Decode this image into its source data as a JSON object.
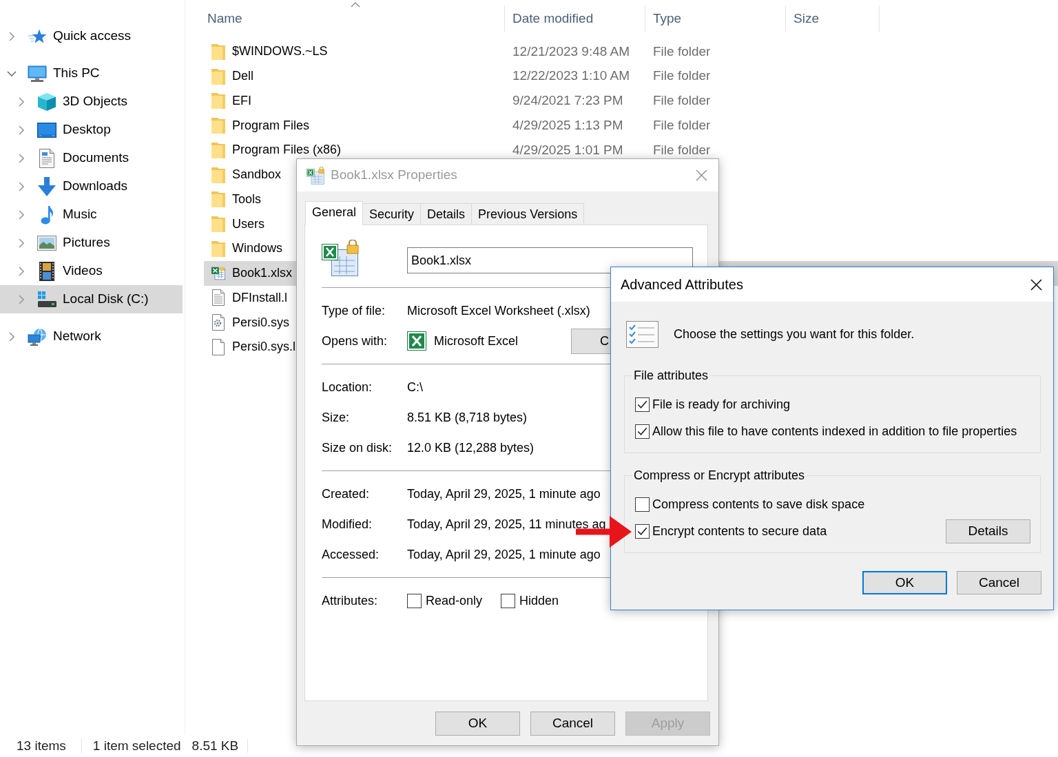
{
  "explorer": {
    "sidebar": {
      "items": [
        {
          "label": "Quick access",
          "kind": "quickaccess",
          "expanded": false,
          "selected": false
        },
        {
          "label": "This PC",
          "kind": "computer",
          "expanded": true,
          "selected": false,
          "children": [
            {
              "label": "3D Objects",
              "kind": "objects",
              "expanded": false,
              "selected": false
            },
            {
              "label": "Desktop",
              "kind": "desktop",
              "expanded": false,
              "selected": false
            },
            {
              "label": "Documents",
              "kind": "documents",
              "expanded": false,
              "selected": false
            },
            {
              "label": "Downloads",
              "kind": "downloads",
              "expanded": false,
              "selected": false
            },
            {
              "label": "Music",
              "kind": "music",
              "expanded": false,
              "selected": false
            },
            {
              "label": "Pictures",
              "kind": "pictures",
              "expanded": false,
              "selected": false
            },
            {
              "label": "Videos",
              "kind": "videos",
              "expanded": false,
              "selected": false
            },
            {
              "label": "Local Disk (C:)",
              "kind": "drive",
              "expanded": false,
              "selected": true
            }
          ]
        },
        {
          "label": "Network",
          "kind": "network",
          "expanded": false,
          "selected": false
        }
      ]
    },
    "file_list": {
      "columns": [
        {
          "label": "Name",
          "sorted": true
        },
        {
          "label": "Date modified",
          "sorted": false
        },
        {
          "label": "Type",
          "sorted": false
        },
        {
          "label": "Size",
          "sorted": false
        }
      ],
      "rows": [
        {
          "name": "$WINDOWS.~LS",
          "kind": "folder",
          "date_modified": "12/21/2023 9:48 AM",
          "type": "File folder",
          "selected": false
        },
        {
          "name": "Dell",
          "kind": "folder",
          "date_modified": "12/22/2023 1:10 AM",
          "type": "File folder",
          "selected": false
        },
        {
          "name": "EFI",
          "kind": "folder",
          "date_modified": "9/24/2021 7:23 PM",
          "type": "File folder",
          "selected": false
        },
        {
          "name": "Program Files",
          "kind": "folder",
          "date_modified": "4/29/2025 1:13 PM",
          "type": "File folder",
          "selected": false
        },
        {
          "name": "Program Files (x86)",
          "kind": "folder",
          "date_modified": "4/29/2025 1:01 PM",
          "type": "File folder",
          "selected": false
        },
        {
          "name": "Sandbox",
          "kind": "folder",
          "selected": false
        },
        {
          "name": "Tools",
          "kind": "folder",
          "selected": false
        },
        {
          "name": "Users",
          "kind": "folder",
          "selected": false
        },
        {
          "name": "Windows",
          "kind": "folder",
          "selected": false
        },
        {
          "name": "Book1.xlsx",
          "kind": "spreadsheet",
          "selected": true
        },
        {
          "name": "DFInstall.l",
          "kind": "text",
          "selected": false
        },
        {
          "name": "Persi0.sys",
          "kind": "system",
          "selected": false
        },
        {
          "name": "Persi0.sys.l",
          "kind": "file",
          "selected": false
        }
      ]
    },
    "status_bar": {
      "item_count": "13 items",
      "selection": "1 item selected",
      "selection_size": "8.51 KB"
    }
  },
  "properties_dialog": {
    "title": "Book1.xlsx Properties",
    "active": false,
    "tabs": [
      {
        "label": "General",
        "selected": true
      },
      {
        "label": "Security",
        "selected": false
      },
      {
        "label": "Details",
        "selected": false
      },
      {
        "label": "Previous Versions",
        "selected": false
      }
    ],
    "file_name": "Book1.xlsx",
    "sections": [
      {
        "rows": [
          {
            "kind": "text",
            "label": "Type of file:",
            "value": "Microsoft Excel Worksheet (.xlsx)"
          },
          {
            "kind": "app",
            "label": "Opens with:",
            "value": "Microsoft Excel",
            "button": "C"
          }
        ]
      },
      {
        "rows": [
          {
            "kind": "text",
            "label": "Location:",
            "value": "C:\\"
          },
          {
            "kind": "text",
            "label": "Size:",
            "value": "8.51 KB (8,718 bytes)"
          },
          {
            "kind": "text",
            "label": "Size on disk:",
            "value": "12.0 KB (12,288 bytes)"
          }
        ]
      },
      {
        "rows": [
          {
            "kind": "text",
            "label": "Created:",
            "value": "Today, April 29, 2025, 1 minute ago"
          },
          {
            "kind": "text",
            "label": "Modified:",
            "value": "Today, April 29, 2025, 11 minutes ag"
          },
          {
            "kind": "text",
            "label": "Accessed:",
            "value": "Today, April 29, 2025, 1 minute ago"
          }
        ]
      },
      {
        "rows": [
          {
            "kind": "checkboxes",
            "label": "Attributes:",
            "options": [
              {
                "label": "Read-only",
                "checked": false
              },
              {
                "label": "Hidden",
                "checked": false
              }
            ]
          }
        ]
      }
    ],
    "buttons": [
      {
        "label": "OK",
        "disabled": false
      },
      {
        "label": "Cancel",
        "disabled": false
      },
      {
        "label": "Apply",
        "disabled": true
      }
    ]
  },
  "advanced_attributes_dialog": {
    "title": "Advanced Attributes",
    "active": true,
    "prompt": "Choose the settings you want for this folder.",
    "groups": [
      {
        "title": "File attributes",
        "options": [
          {
            "label": "File is ready for archiving",
            "checked": true
          },
          {
            "label": "Allow this file to have contents indexed in addition to file properties",
            "checked": true
          }
        ]
      },
      {
        "title": "Compress or Encrypt attributes",
        "options": [
          {
            "label": "Compress contents to save disk space",
            "checked": false
          },
          {
            "label": "Encrypt contents to secure data",
            "checked": true,
            "button": "Details"
          }
        ]
      }
    ],
    "buttons": [
      {
        "label": "OK",
        "default": true
      },
      {
        "label": "Cancel",
        "default": false
      }
    ]
  }
}
